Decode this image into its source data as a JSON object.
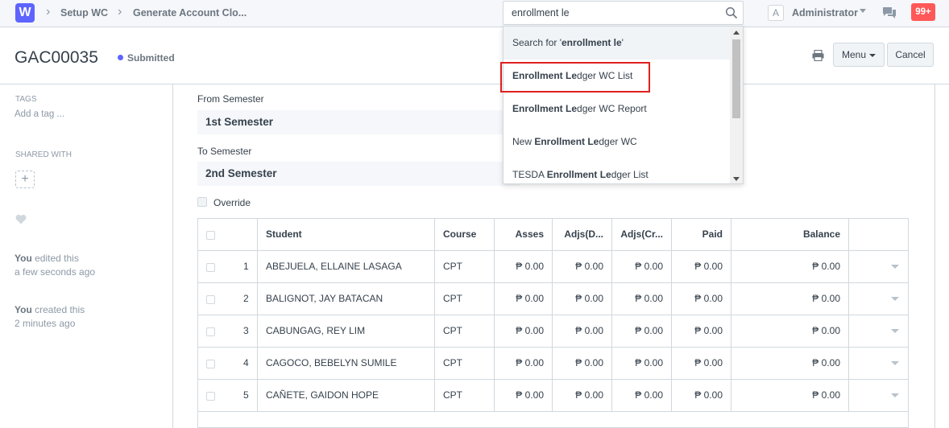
{
  "navbar": {
    "logo": "W",
    "breadcrumbs": [
      "Setup WC",
      "Generate Account Clo..."
    ],
    "search_value": "enrollment le",
    "avatar_letter": "A",
    "user": "Administrator",
    "notifications": "99+"
  },
  "page": {
    "title": "GAC00035",
    "status": "Submitted",
    "status_color": "#5e64ff",
    "menu_label": "Menu",
    "cancel_label": "Cancel"
  },
  "sidebar": {
    "tags_label": "TAGS",
    "add_tag": "Add a tag ...",
    "shared_label": "SHARED WITH",
    "add_user_symbol": "+",
    "activity": [
      {
        "who": "You",
        "action": " edited this",
        "when": "a few seconds ago"
      },
      {
        "who": "You",
        "action": " created this",
        "when": "2 minutes ago"
      }
    ]
  },
  "form": {
    "from_label": "From Semester",
    "from_value": "1st Semester",
    "to_label": "To Semester",
    "to_value": "2nd Semester",
    "override_label": "Override"
  },
  "table": {
    "headers": [
      "Student",
      "Course",
      "Asses",
      "Adjs(D...",
      "Adjs(Cr...",
      "Paid",
      "Balance"
    ],
    "rows": [
      {
        "idx": "1",
        "student": "ABEJUELA, ELLAINE LASAGA",
        "course": "CPT",
        "asses": "₱ 0.00",
        "adjs_d": "₱ 0.00",
        "adjs_c": "₱ 0.00",
        "paid": "₱ 0.00",
        "balance": "₱ 0.00"
      },
      {
        "idx": "2",
        "student": "BALIGNOT, JAY BATACAN",
        "course": "CPT",
        "asses": "₱ 0.00",
        "adjs_d": "₱ 0.00",
        "adjs_c": "₱ 0.00",
        "paid": "₱ 0.00",
        "balance": "₱ 0.00"
      },
      {
        "idx": "3",
        "student": "CABUNGAG, REY LIM",
        "course": "CPT",
        "asses": "₱ 0.00",
        "adjs_d": "₱ 0.00",
        "adjs_c": "₱ 0.00",
        "paid": "₱ 0.00",
        "balance": "₱ 0.00"
      },
      {
        "idx": "4",
        "student": "CAGOCO, BEBELYN SUMILE",
        "course": "CPT",
        "asses": "₱ 0.00",
        "adjs_d": "₱ 0.00",
        "adjs_c": "₱ 0.00",
        "paid": "₱ 0.00",
        "balance": "₱ 0.00"
      },
      {
        "idx": "5",
        "student": "CAÑETE, GAIDON HOPE",
        "course": "CPT",
        "asses": "₱ 0.00",
        "adjs_d": "₱ 0.00",
        "adjs_c": "₱ 0.00",
        "paid": "₱ 0.00",
        "balance": "₱ 0.00"
      }
    ]
  },
  "dropdown": {
    "items": [
      {
        "pre": "Search for '",
        "bold": "enrollment le",
        "post": "'"
      },
      {
        "pre": "",
        "bold": "Enrollment Le",
        "post": "dger WC List"
      },
      {
        "pre": "",
        "bold": "Enrollment Le",
        "post": "dger WC Report"
      },
      {
        "pre": "New ",
        "bold": "Enrollment Le",
        "post": "dger WC"
      },
      {
        "pre": "TESDA ",
        "bold": "Enrollment Le",
        "post": "dger List"
      }
    ],
    "highlight_color": "#e02020"
  }
}
